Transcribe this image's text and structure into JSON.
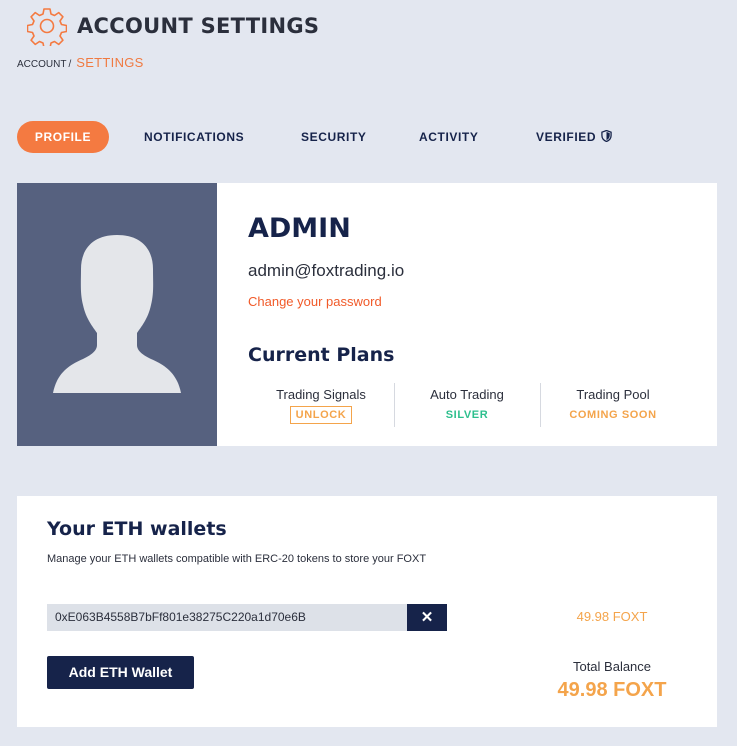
{
  "header": {
    "title": "ACCOUNT SETTINGS",
    "icon": "gear-icon",
    "icon_color": "#f47a41"
  },
  "breadcrumb": {
    "root": "ACCOUNT",
    "separator": "/",
    "current": "SETTINGS"
  },
  "tabs": [
    {
      "label": "PROFILE",
      "active": true
    },
    {
      "label": "NOTIFICATIONS",
      "active": false
    },
    {
      "label": "SECURITY",
      "active": false
    },
    {
      "label": "ACTIVITY",
      "active": false
    },
    {
      "label": "VERIFIED",
      "active": false,
      "icon": "shield-icon"
    }
  ],
  "profile": {
    "username": "ADMIN",
    "email": "admin@foxtrading.io",
    "change_password": "Change your password",
    "plans_title": "Current Plans",
    "plans": [
      {
        "name": "Trading Signals",
        "value": "UNLOCK",
        "color": "#f4a44b"
      },
      {
        "name": "Auto Trading",
        "value": "SILVER",
        "color": "#2dbf8d"
      },
      {
        "name": "Trading Pool",
        "value": "COMING SOON",
        "color": "#f4a44b"
      }
    ]
  },
  "wallets": {
    "title": "Your ETH wallets",
    "description": "Manage your ETH wallets compatible with ERC-20 tokens to store your FOXT",
    "items": [
      {
        "address": "0xE063B4558B7bFf801e38275C220a1d70e6B",
        "remove_icon": "close-icon",
        "balance": "49.98 FOXT"
      }
    ],
    "add_button": "Add ETH Wallet",
    "total_label": "Total Balance",
    "total_value": "49.98 FOXT"
  },
  "colors": {
    "accent": "#f47a41",
    "navy": "#16234a",
    "background": "#e3e7f0",
    "avatar_bg": "#56617f"
  }
}
